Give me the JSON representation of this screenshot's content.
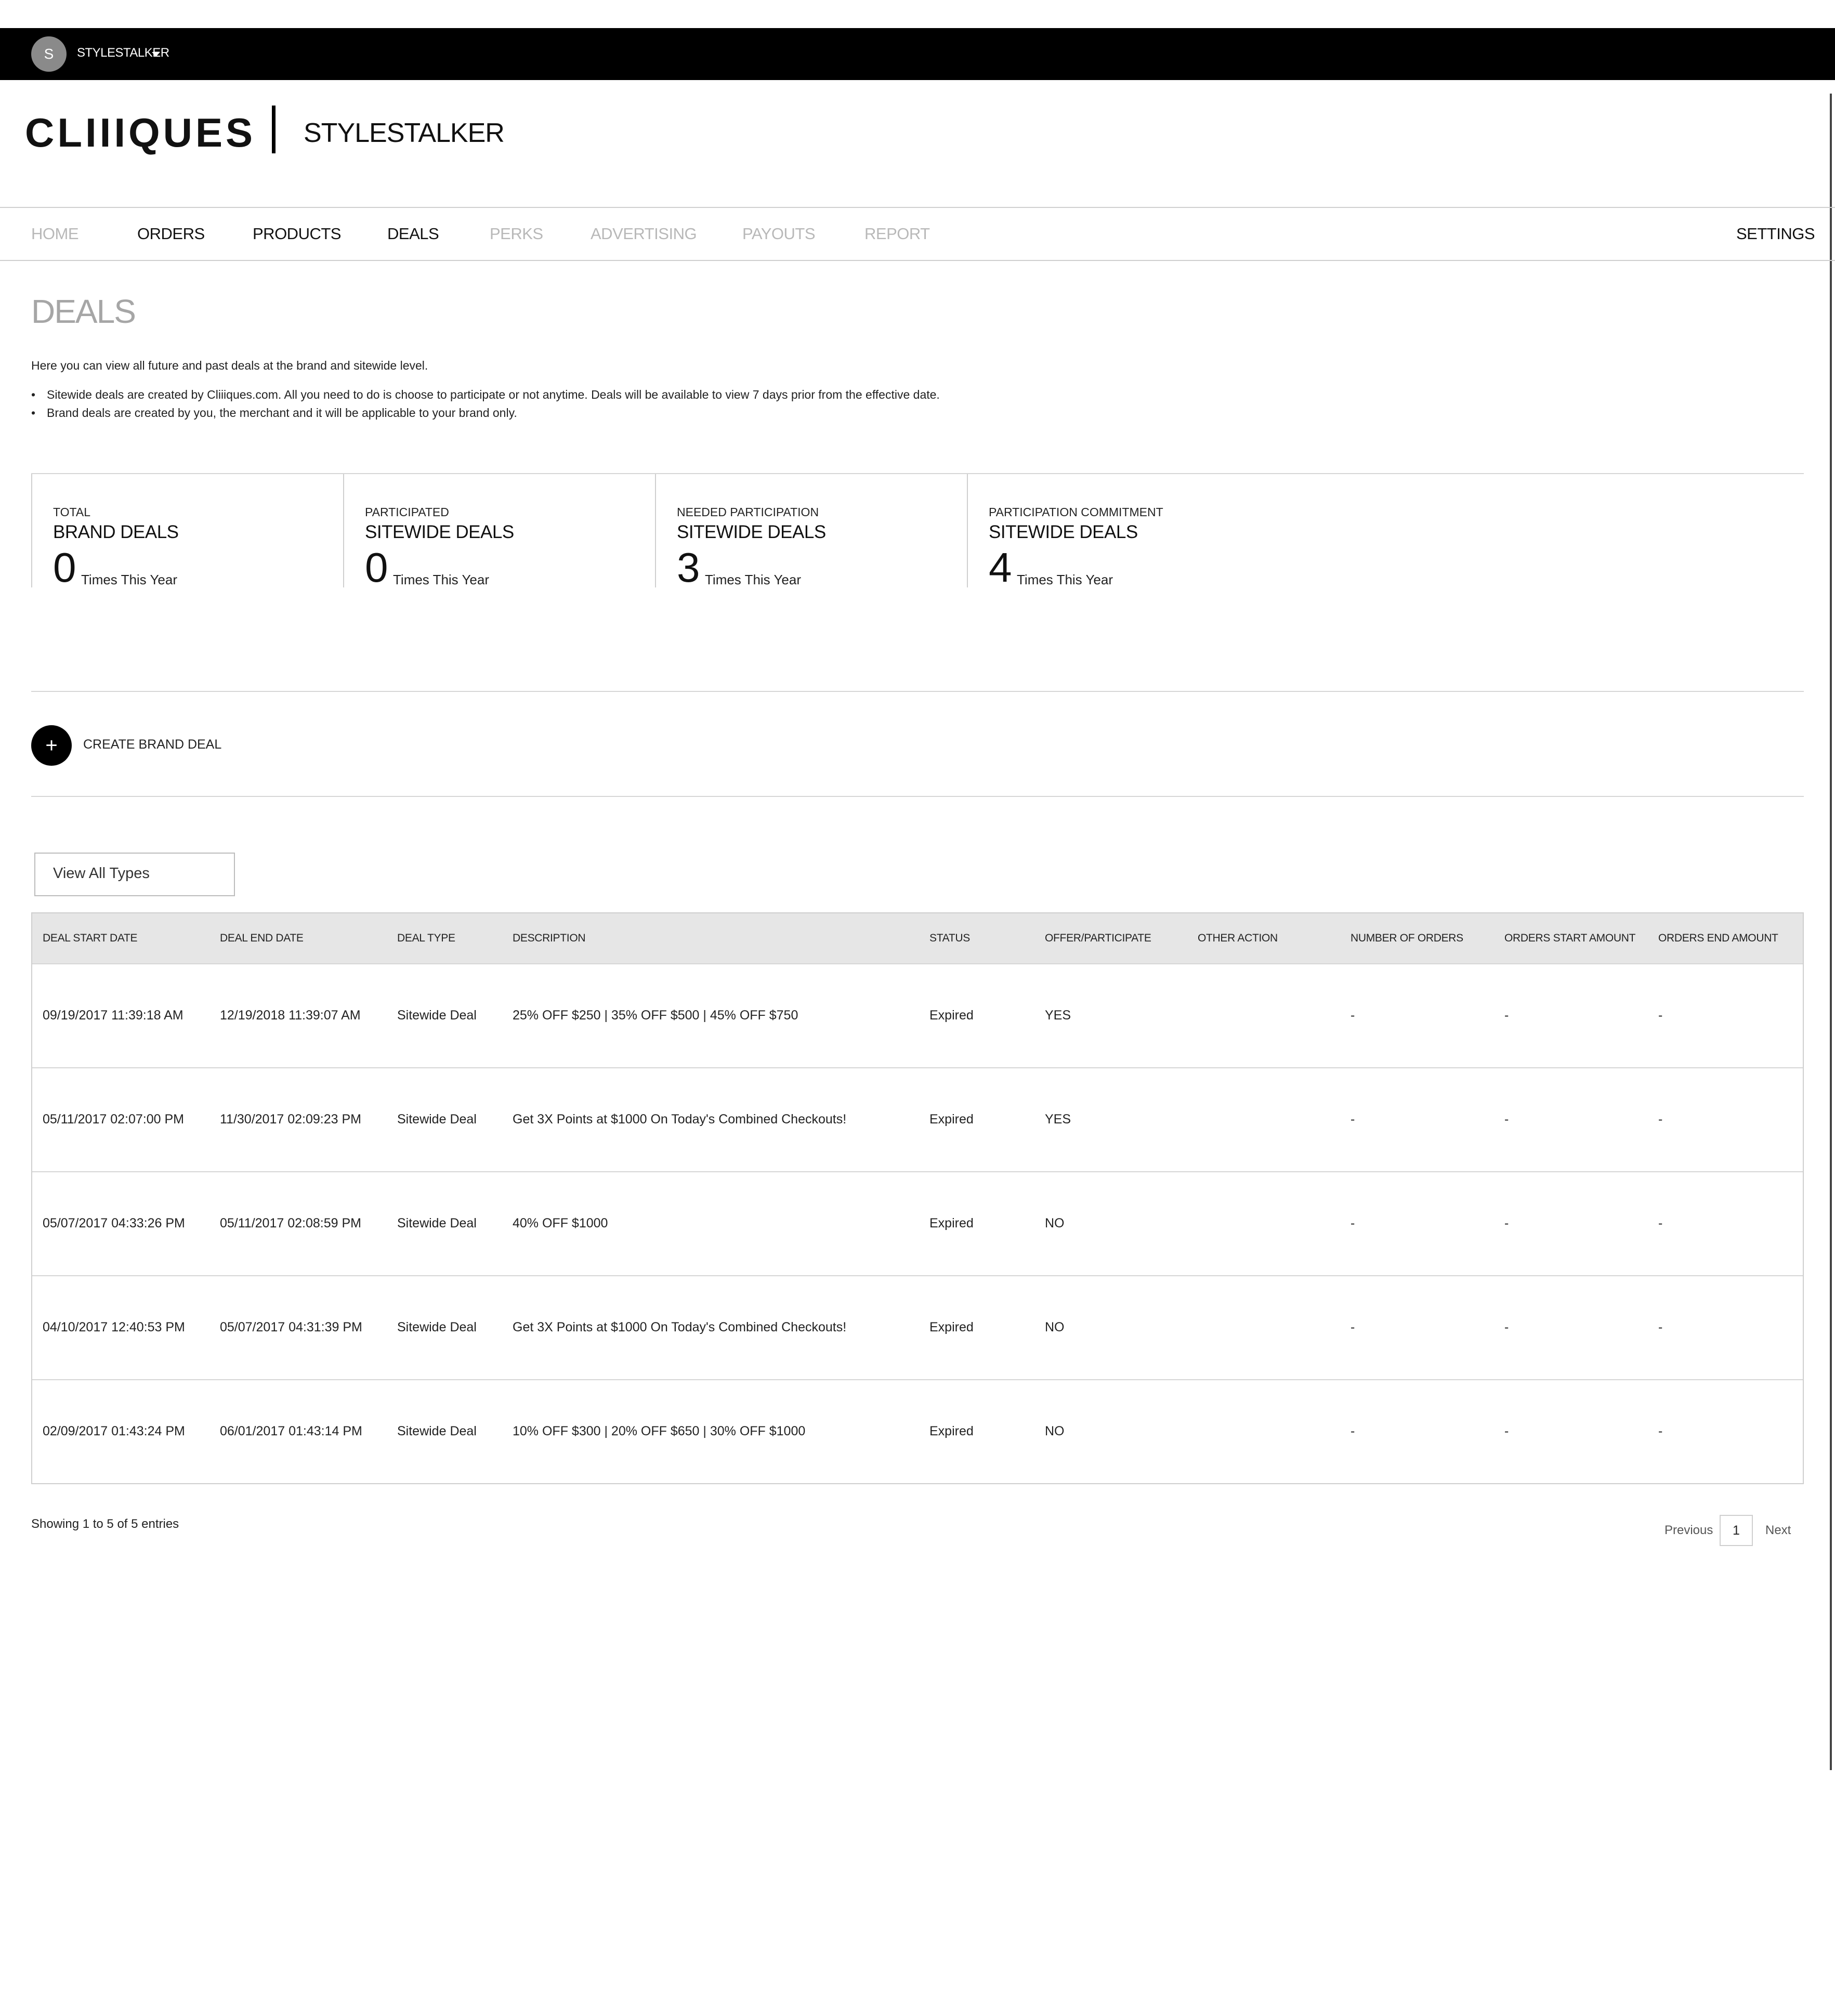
{
  "topbar": {
    "avatar_letter": "S",
    "user_name": "STYLESTALKER"
  },
  "header": {
    "logo": "CLIIIQUES",
    "brand": "STYLESTALKER"
  },
  "nav": {
    "items": [
      "HOME",
      "ORDERS",
      "PRODUCTS",
      "DEALS",
      "PERKS",
      "ADVERTISING",
      "PAYOUTS",
      "REPORT"
    ],
    "settings": "SETTINGS"
  },
  "page": {
    "title": "DEALS",
    "intro": "Here you can view all future and past deals at the brand and sitewide level.",
    "bullets": [
      "Sitewide deals are created by Cliiiques.com. All you need to do is choose to participate or not anytime. Deals will be available to view 7 days prior from the effective date.",
      "Brand deals are created by you, the merchant and it will be applicable to your brand only."
    ]
  },
  "stats": [
    {
      "small": "TOTAL",
      "big": "BRAND DEALS",
      "number": "0",
      "unit": "Times This Year"
    },
    {
      "small": "PARTICIPATED",
      "big": "SITEWIDE DEALS",
      "number": "0",
      "unit": "Times This Year"
    },
    {
      "small": "NEEDED PARTICIPATION",
      "big": "SITEWIDE DEALS",
      "number": "3",
      "unit": "Times This Year"
    },
    {
      "small": "PARTICIPATION COMMITMENT",
      "big": "SITEWIDE DEALS",
      "number": "4",
      "unit": "Times This Year"
    }
  ],
  "create": {
    "icon": "+",
    "label": "CREATE BRAND DEAL"
  },
  "filter": {
    "selected": "View All Types"
  },
  "table": {
    "headers": [
      "DEAL START DATE",
      "DEAL END DATE",
      "DEAL TYPE",
      "DESCRIPTION",
      "STATUS",
      "OFFER/PARTICIPATE",
      "OTHER ACTION",
      "NUMBER OF ORDERS",
      "ORDERS START AMOUNT",
      "ORDERS END AMOUNT"
    ],
    "rows": [
      {
        "start": "09/19/2017 11:39:18 AM",
        "end": "12/19/2018 11:39:07 AM",
        "type": "Sitewide Deal",
        "description": "25% OFF $250 | 35% OFF $500 | 45% OFF $750",
        "status": "Expired",
        "offer": "YES",
        "other": "",
        "orders": "-",
        "start_amount": "-",
        "end_amount": "-"
      },
      {
        "start": "05/11/2017 02:07:00 PM",
        "end": "11/30/2017 02:09:23 PM",
        "type": "Sitewide Deal",
        "description": "Get 3X Points at $1000 On Today's Combined Checkouts!",
        "status": "Expired",
        "offer": "YES",
        "other": "",
        "orders": "-",
        "start_amount": "-",
        "end_amount": "-"
      },
      {
        "start": "05/07/2017 04:33:26 PM",
        "end": "05/11/2017 02:08:59 PM",
        "type": "Sitewide Deal",
        "description": "40% OFF $1000",
        "status": "Expired",
        "offer": "NO",
        "other": "",
        "orders": "-",
        "start_amount": "-",
        "end_amount": "-"
      },
      {
        "start": "04/10/2017 12:40:53 PM",
        "end": "05/07/2017 04:31:39 PM",
        "type": "Sitewide Deal",
        "description": "Get 3X Points at $1000 On Today's Combined Checkouts!",
        "status": "Expired",
        "offer": "NO",
        "other": "",
        "orders": "-",
        "start_amount": "-",
        "end_amount": "-"
      },
      {
        "start": "02/09/2017 01:43:24 PM",
        "end": "06/01/2017 01:43:14 PM",
        "type": "Sitewide Deal",
        "description": "10% OFF $300 | 20% OFF $650 | 30% OFF $1000",
        "status": "Expired",
        "offer": "NO",
        "other": "",
        "orders": "-",
        "start_amount": "-",
        "end_amount": "-"
      }
    ]
  },
  "pagination": {
    "showing": "Showing 1 to 5 of 5 entries",
    "previous": "Previous",
    "current": "1",
    "next": "Next"
  }
}
